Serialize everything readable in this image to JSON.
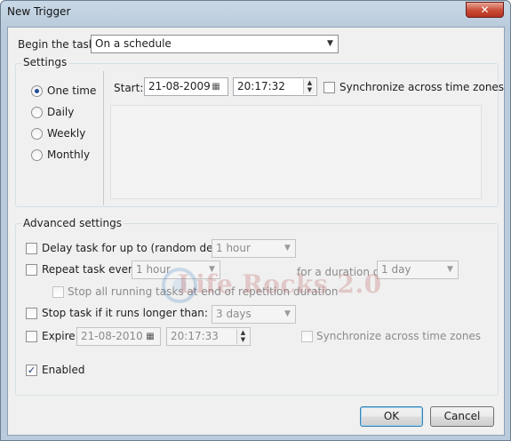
{
  "window": {
    "title": "New Trigger",
    "close_glyph": "✕"
  },
  "begin_task": {
    "label": "Begin the task:",
    "value": "On a schedule"
  },
  "settings": {
    "legend": "Settings",
    "schedule_options": [
      {
        "label": "One time",
        "selected": true
      },
      {
        "label": "Daily",
        "selected": false
      },
      {
        "label": "Weekly",
        "selected": false
      },
      {
        "label": "Monthly",
        "selected": false
      }
    ],
    "start_label": "Start:",
    "start_date": "21-08-2009",
    "start_time": "20:17:32",
    "sync_label": "Synchronize across time zones",
    "sync_checked": false
  },
  "advanced": {
    "legend": "Advanced settings",
    "delay": {
      "label": "Delay task for up to (random delay):",
      "value": "1 hour",
      "checked": false
    },
    "repeat": {
      "label": "Repeat task every:",
      "value": "1 hour",
      "checked": false,
      "duration_label": "for a duration of:",
      "duration_value": "1 day",
      "stop_all_label": "Stop all running tasks at end of repetition duration"
    },
    "stop_longer": {
      "label": "Stop task if it runs longer than:",
      "value": "3 days",
      "checked": false
    },
    "expire": {
      "label": "Expire:",
      "date": "21-08-2010",
      "time": "20:17:33",
      "checked": false,
      "sync_label": "Synchronize across time zones"
    },
    "enabled": {
      "label": "Enabled",
      "checked": true
    }
  },
  "footer": {
    "ok_label": "OK",
    "cancel_label": "Cancel"
  },
  "watermark": {
    "text": "Life Rocks 2.0"
  },
  "icons": {
    "dropdown": "▼",
    "calendar": "▦",
    "spin_up": "▲",
    "spin_down": "▼",
    "check": "✓"
  },
  "colors": {
    "accent": "#1f4f9a",
    "title_bar": "#c9d8e6",
    "close": "#c94b35"
  }
}
